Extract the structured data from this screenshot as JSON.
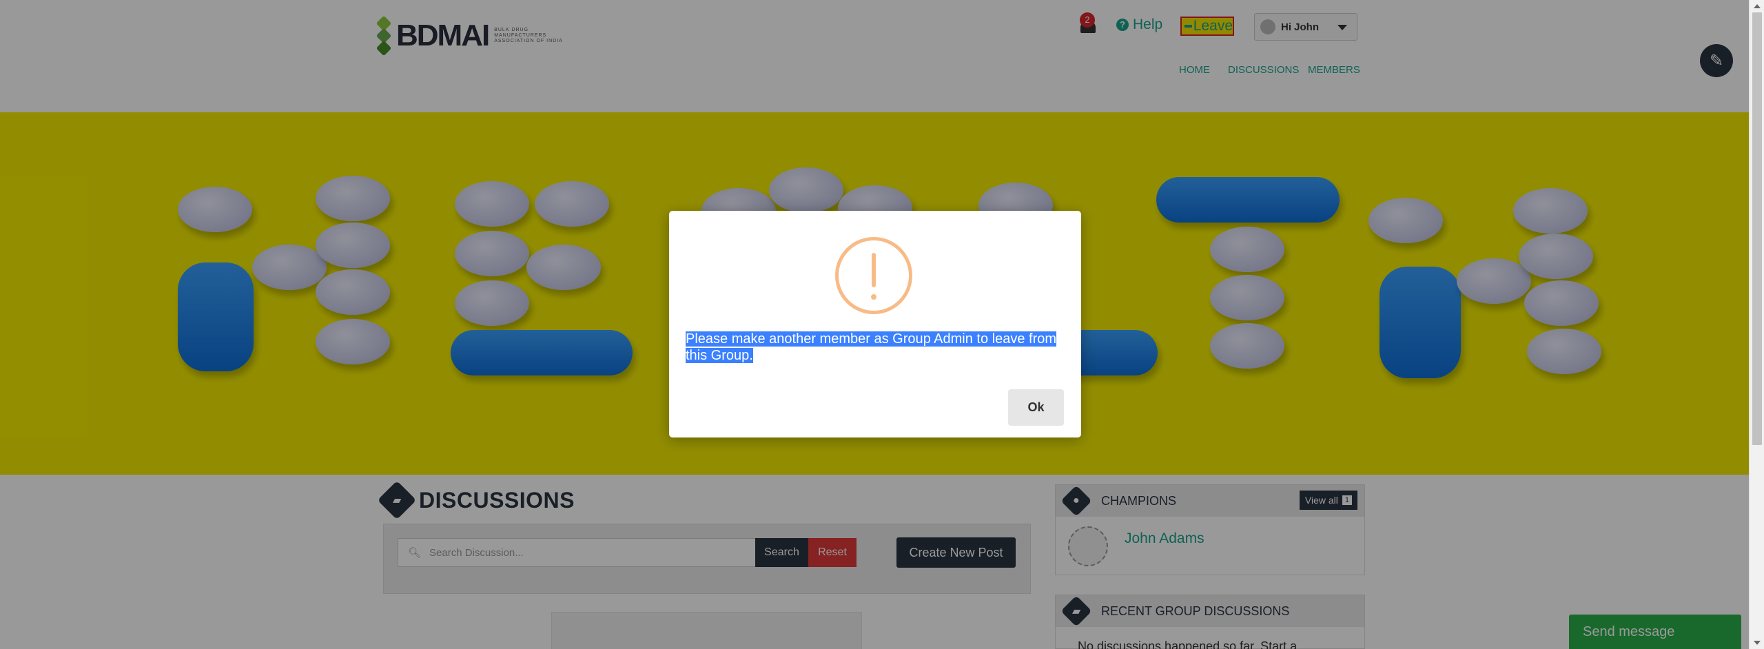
{
  "header": {
    "logo_text": "BDMAI",
    "logo_subtitle_lines": [
      "BULK DRUG",
      "MANUFACTURERS",
      "ASSOCIATION OF INDIA"
    ],
    "notification_count": "2",
    "help_label": "Help",
    "leave_label": "Leave",
    "user_greeting": "Hi John",
    "nav": [
      {
        "label": "HOME"
      },
      {
        "label": "DISCUSSIONS"
      },
      {
        "label": "MEMBERS"
      }
    ]
  },
  "discussions": {
    "title": "DISCUSSIONS",
    "search_placeholder": "Search Discussion...",
    "search_label": "Search",
    "reset_label": "Reset",
    "create_label": "Create New Post"
  },
  "champions": {
    "title": "CHAMPIONS",
    "view_all_label": "View all",
    "view_all_count": "1",
    "members": [
      {
        "name": "John Adams"
      }
    ]
  },
  "recent": {
    "title": "RECENT GROUP DISCUSSIONS",
    "empty_text": "No discussions happened so far. Start a"
  },
  "send_message_label": "Send message",
  "modal": {
    "message": "Please make another member as Group Admin to leave from this Group.",
    "ok_label": "Ok"
  },
  "colors": {
    "brand_dark": "#2a3542",
    "accent_green": "#1aa38a",
    "warning": "#f8bb86",
    "danger": "#e03a3a",
    "send_green": "#2ab04a"
  }
}
